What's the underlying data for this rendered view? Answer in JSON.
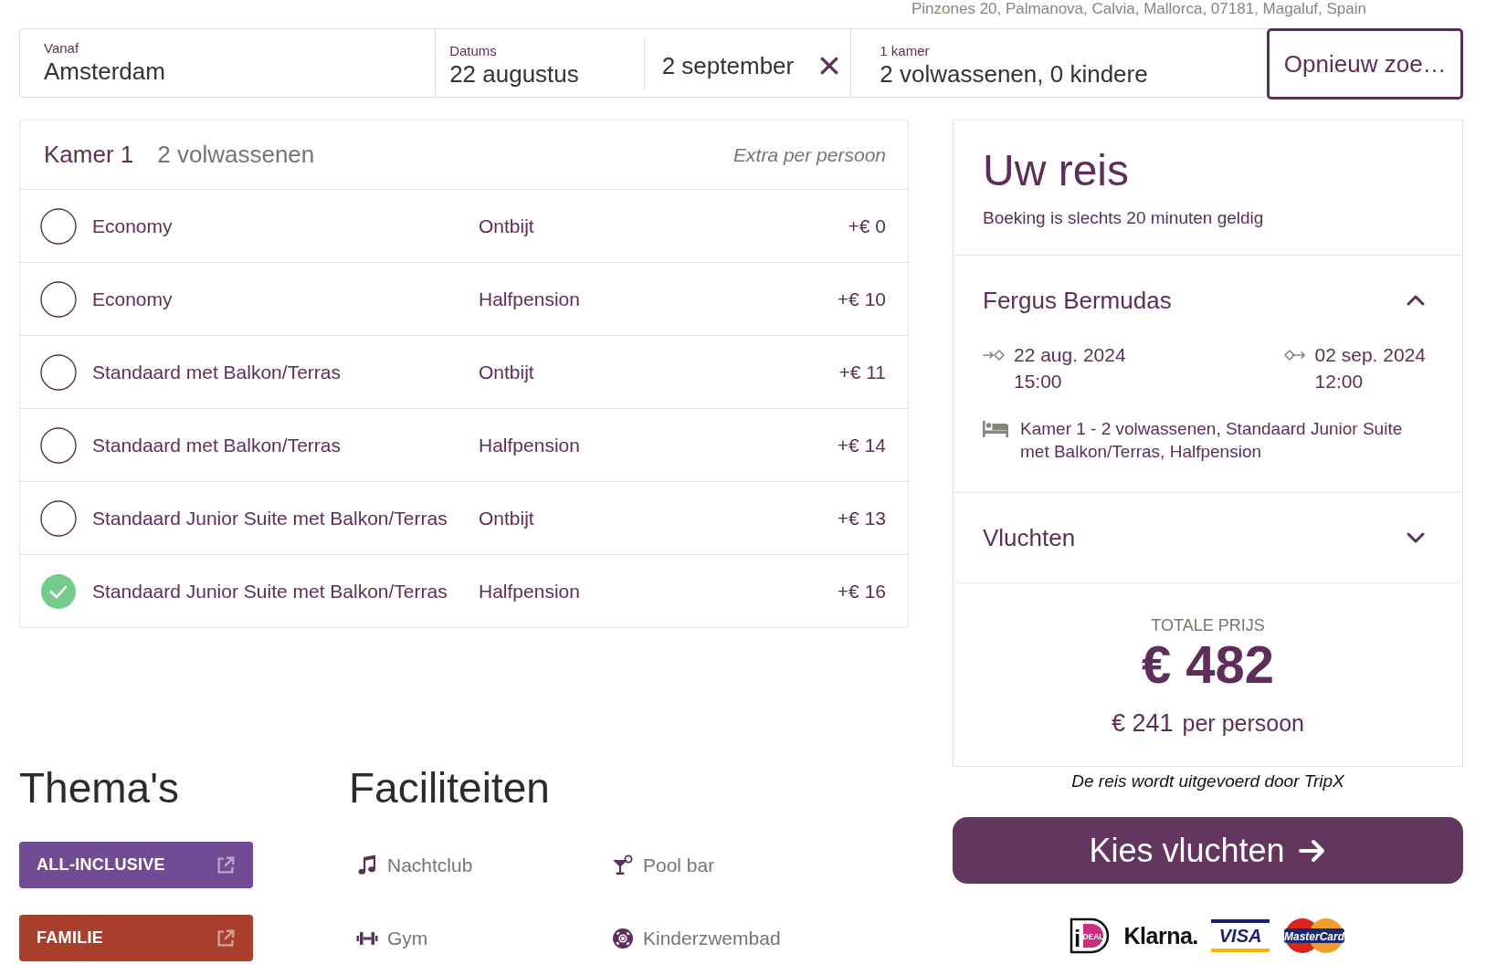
{
  "address": "Pinzones 20, Palmanova, Calvia, Mallorca, 07181, Magaluf, Spain",
  "search": {
    "from": {
      "label": "Vanaf",
      "value": "Amsterdam"
    },
    "dates": {
      "label": "Datums",
      "start": "22 augustus",
      "end": "2 september"
    },
    "rooms": {
      "label": "1 kamer",
      "value": "2 volwassenen, 0 kindere"
    },
    "button": "Opnieuw zoe…"
  },
  "room": {
    "title": "Kamer 1",
    "guests": "2 volwassenen",
    "price_header": "Extra per persoon",
    "options": [
      {
        "name": "Economy",
        "board": "Ontbijt",
        "price": "+€ 0",
        "selected": false
      },
      {
        "name": "Economy",
        "board": "Halfpension",
        "price": "+€ 10",
        "selected": false
      },
      {
        "name": "Standaard met Balkon/Terras",
        "board": "Ontbijt",
        "price": "+€ 11",
        "selected": false
      },
      {
        "name": "Standaard met Balkon/Terras",
        "board": "Halfpension",
        "price": "+€ 14",
        "selected": false
      },
      {
        "name": "Standaard Junior Suite met Balkon/Terras",
        "board": "Ontbijt",
        "price": "+€ 13",
        "selected": false
      },
      {
        "name": "Standaard Junior Suite met Balkon/Terras",
        "board": "Halfpension",
        "price": "+€ 16",
        "selected": true
      }
    ]
  },
  "themes": {
    "title": "Thema's",
    "items": [
      {
        "label": "ALL-INCLUSIVE",
        "color": "#714b93"
      },
      {
        "label": "FAMILIE",
        "color": "#a9402d"
      }
    ]
  },
  "facilities": {
    "title": "Faciliteiten",
    "items": [
      {
        "kind": "music",
        "label": "Nachtclub"
      },
      {
        "kind": "cocktail",
        "label": "Pool bar"
      },
      {
        "kind": "dumbbell",
        "label": "Gym"
      },
      {
        "kind": "lifebuoy",
        "label": "Kinderzwembad"
      }
    ]
  },
  "summary": {
    "title": "Uw reis",
    "subtitle": "Boeking is slechts 20 minuten geldig",
    "sections": [
      {
        "kind": "hotel",
        "title": "Fergus Bermudas",
        "expanded": true,
        "checkin": {
          "date": "22 aug. 2024",
          "time": "15:00"
        },
        "checkout": {
          "date": "02 sep. 2024",
          "time": "12:00"
        },
        "room": "Kamer 1 - 2 volwassenen, Standaard Junior Suite met Balkon/Terras, Halfpension"
      },
      {
        "kind": "flights",
        "title": "Vluchten",
        "expanded": false
      }
    ],
    "total_label": "TOTALE PRIJS",
    "total": "€ 482",
    "per_person_amount": "€ 241",
    "per_person_label": "per persoon"
  },
  "operator_note": "De reis wordt uitgevoerd door TripX",
  "cta": {
    "label": "Kies vluchten"
  },
  "payment_methods": [
    {
      "kind": "ideal",
      "mark": "i",
      "label": "DEAL"
    },
    {
      "kind": "klarna",
      "label": "Klarna."
    },
    {
      "kind": "visa",
      "label": "VISA"
    },
    {
      "kind": "mastercard",
      "label": "MasterCard"
    }
  ]
}
